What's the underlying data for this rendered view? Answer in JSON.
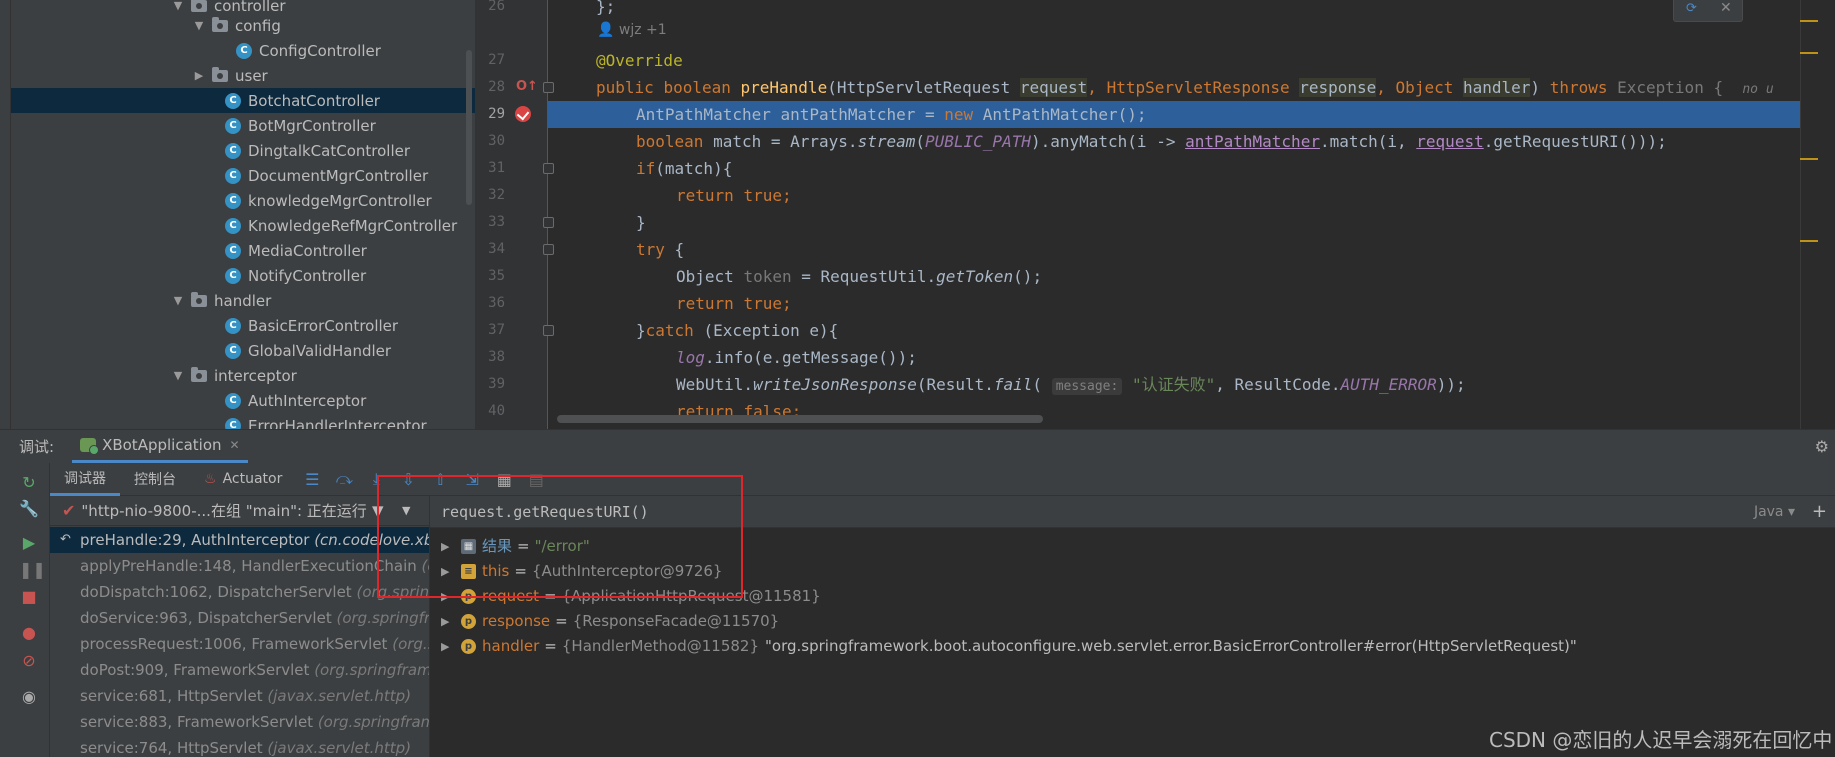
{
  "project_tree": {
    "items": [
      {
        "label": "controller",
        "kind": "folder",
        "indent": 2,
        "expanded": true
      },
      {
        "label": "config",
        "kind": "folder",
        "indent": 3,
        "expanded": true
      },
      {
        "label": "ConfigController",
        "kind": "class",
        "indent": 4
      },
      {
        "label": "user",
        "kind": "folder",
        "indent": 3,
        "expanded": false
      },
      {
        "label": "BotchatController",
        "kind": "class",
        "indent": 3,
        "selected": true
      },
      {
        "label": "BotMgrController",
        "kind": "class",
        "indent": 3
      },
      {
        "label": "DingtalkCatController",
        "kind": "class",
        "indent": 3
      },
      {
        "label": "DocumentMgrController",
        "kind": "class",
        "indent": 3
      },
      {
        "label": "knowledgeMgrController",
        "kind": "class",
        "indent": 3
      },
      {
        "label": "KnowledgeRefMgrController",
        "kind": "class",
        "indent": 3
      },
      {
        "label": "MediaController",
        "kind": "class",
        "indent": 3
      },
      {
        "label": "NotifyController",
        "kind": "class",
        "indent": 3
      },
      {
        "label": "handler",
        "kind": "folder",
        "indent": 2,
        "expanded": true
      },
      {
        "label": "BasicErrorController",
        "kind": "class",
        "indent": 3
      },
      {
        "label": "GlobalValidHandler",
        "kind": "class",
        "indent": 3
      },
      {
        "label": "interceptor",
        "kind": "folder",
        "indent": 2,
        "expanded": true
      },
      {
        "label": "AuthInterceptor",
        "kind": "class",
        "indent": 3
      },
      {
        "label": "ErrorHandlerInterceptor",
        "kind": "class",
        "indent": 3
      }
    ]
  },
  "editor": {
    "line_numbers": [
      "26",
      "27",
      "28",
      "29",
      "30",
      "31",
      "32",
      "33",
      "34",
      "35",
      "36",
      "37",
      "38",
      "39",
      "40"
    ],
    "current_line": "29",
    "author_hint": "wjz +1",
    "lines": {
      "l26": "};",
      "l27": "@Override",
      "l28_public": "public ",
      "l28_boolean": "boolean ",
      "l28_method": "preHandle",
      "l28_open": "(HttpServletRequest ",
      "l28_request": "request",
      "l28_sep1": ", HttpServletResponse ",
      "l28_response": "response",
      "l28_sep2": ", Object ",
      "l28_handler": "handler",
      "l28_close": ") ",
      "l28_throws": "throws ",
      "l28_exception": "Exception {",
      "l28_trailer": "no u",
      "l29_text": "AntPathMatcher antPathMatcher = ",
      "l29_new": "new ",
      "l29_rest": "AntPathMatcher();",
      "l30_boolean": "boolean ",
      "l30_a": "match = Arrays.",
      "l30_stream": "stream",
      "l30_b": "(",
      "l30_const": "PUBLIC_PATH",
      "l30_c": ").anyMatch(i -> ",
      "l30_matcher": "antPathMatcher",
      "l30_d": ".match(i, ",
      "l30_request": "request",
      "l30_e": ".getRequestURI()));",
      "l31_if": "if",
      "l31_rest": "(match){",
      "l32_return": "return ",
      "l32_true": "true;",
      "l33": "}",
      "l34_try": "try ",
      "l34_brace": "{",
      "l35_a": "Object ",
      "l35_token": "token",
      "l35_b": " = RequestUtil.",
      "l35_get": "getToken",
      "l35_c": "();",
      "l36_return": "return ",
      "l36_true": "true;",
      "l37_a": "}",
      "l37_catch": "catch ",
      "l37_rest": "(Exception e){",
      "l38_log": "log",
      "l38_rest": ".info(e.getMessage());",
      "l39_a": "WebUtil.",
      "l39_write": "writeJsonResponse",
      "l39_b": "(Result.",
      "l39_fail": "fail",
      "l39_c": "( ",
      "l39_hint": "message:",
      "l39_str": " \"认证失败\"",
      "l39_d": ", ResultCode.",
      "l39_const": "AUTH_ERROR",
      "l39_e": "));",
      "l40_return": "return ",
      "l40_false": "false;"
    }
  },
  "debug": {
    "title_label": "调试:",
    "run_config": "XBotApplication",
    "tabs": {
      "debugger": "调试器",
      "console": "控制台",
      "actuator": "Actuator"
    },
    "thread": "\"http-nio-9800-...在组 \"main\": 正在运行",
    "frames": [
      {
        "method": "preHandle:29, AuthInterceptor ",
        "pkg": "(cn.codelove.xbot"
      },
      {
        "method": "applyPreHandle:148, HandlerExecutionChain ",
        "pkg": "(or"
      },
      {
        "method": "doDispatch:1062, DispatcherServlet ",
        "pkg": "(org.spring"
      },
      {
        "method": "doService:963, DispatcherServlet ",
        "pkg": "(org.springfra"
      },
      {
        "method": "processRequest:1006, FrameworkServlet ",
        "pkg": "(org.sp"
      },
      {
        "method": "doPost:909, FrameworkServlet ",
        "pkg": "(org.springframe"
      },
      {
        "method": "service:681, HttpServlet ",
        "pkg": "(javax.servlet.http)"
      },
      {
        "method": "service:883, FrameworkServlet ",
        "pkg": "(org.springframe"
      },
      {
        "method": "service:764, HttpServlet ",
        "pkg": "(javax.servlet.http)"
      }
    ],
    "evaluate_expression": "request.getRequestURI()",
    "language": "Java",
    "variables": [
      {
        "icon": "calc",
        "name": "结果",
        "value": "\"/error\"",
        "value_is_string": true
      },
      {
        "icon": "this",
        "name": "this",
        "value": "{AuthInterceptor@9726}"
      },
      {
        "icon": "param",
        "name": "request",
        "value": "{ApplicationHttpRequest@11581}"
      },
      {
        "icon": "param",
        "name": "response",
        "value": "{ResponseFacade@11570}"
      },
      {
        "icon": "param",
        "name": "handler",
        "value": "{HandlerMethod@11582}",
        "tail": "\"org.springframework.boot.autoconfigure.web.servlet.error.BasicErrorController#error(HttpServletRequest)\""
      }
    ]
  },
  "watermark": "CSDN @恋旧的人迟早会溺死在回忆中",
  "colors": {
    "accent": "#4a88c7",
    "highlight": "#2d5f9a",
    "annotation_box": "#e0252b"
  }
}
